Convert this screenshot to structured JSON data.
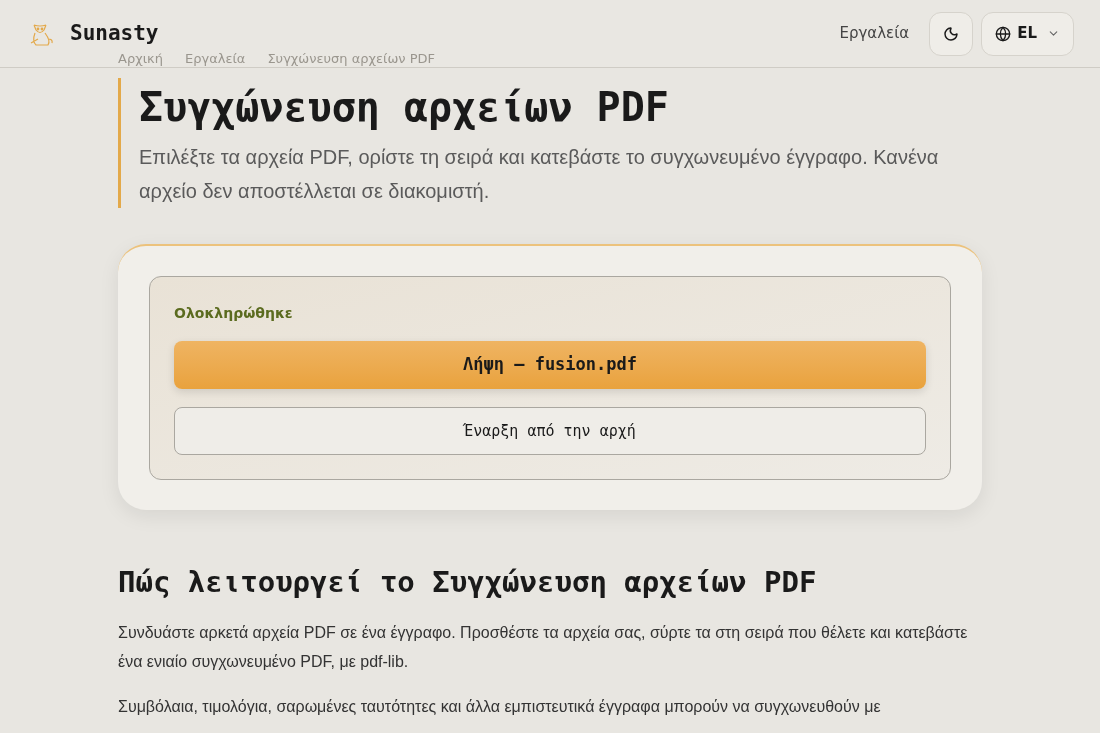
{
  "header": {
    "brand": "Sunasty",
    "nav_link": "Εργαλεία",
    "language": "EL"
  },
  "breadcrumb": [
    "Αρχική",
    "Εργαλεία",
    "Συγχώνευση αρχείων PDF"
  ],
  "page": {
    "title": "Συγχώνευση αρχείων PDF",
    "subtitle": "Επιλέξτε τα αρχεία PDF, ορίστε τη σειρά και κατεβάστε το συγχωνευμένο έγγραφο. Κανένα αρχείο δεν αποστέλλεται σε διακομιστή."
  },
  "result": {
    "status": "Ολοκληρώθηκε",
    "download_button": "Λήψη — fusion.pdf",
    "restart_button": "Έναρξη από την αρχή"
  },
  "how_it_works": {
    "heading": "Πώς λειτουργεί το Συγχώνευση αρχείων PDF",
    "paragraphs": [
      "Συνδυάστε αρκετά αρχεία PDF σε ένα έγγραφο. Προσθέστε τα αρχεία σας, σύρτε τα στη σειρά που θέλετε και κατεβάστε ένα ενιαίο συγχωνευμένο PDF, με pdf-lib.",
      "Συμβόλαια, τιμολόγια, σαρωμένες ταυτότητες και άλλα εμπιστευτικά έγγραφα μπορούν να συγχωνευθούν με"
    ]
  }
}
